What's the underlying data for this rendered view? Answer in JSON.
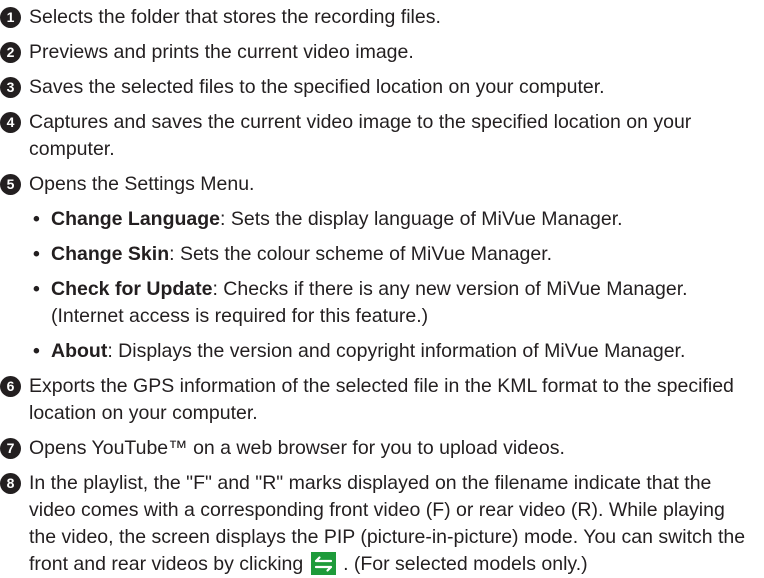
{
  "items": [
    {
      "num": "1",
      "text": "Selects the folder that stores the recording files."
    },
    {
      "num": "2",
      "text": "Previews and prints the current video image."
    },
    {
      "num": "3",
      "text": "Saves the selected files to the specified location on your computer."
    },
    {
      "num": "4",
      "text": "Captures and saves the current video image to the specified location on your computer."
    },
    {
      "num": "5",
      "text": "Opens the Settings Menu."
    },
    {
      "num": "6",
      "text": "Exports the GPS information of the selected file in the KML format to the specified location on your computer."
    },
    {
      "num": "7",
      "text": "Opens YouTube™ on a web browser for you to upload videos."
    },
    {
      "num": "8",
      "text_before_icon": "In the playlist, the \"F\" and \"R\" marks displayed on the filename indicate that the video comes with a corresponding front video (F) or rear video (R). While playing the video, the screen displays the PIP (picture-in-picture) mode. You can switch the front and rear videos by clicking",
      "text_after_icon": ". (For selected models only.)"
    }
  ],
  "settings_menu": [
    {
      "bullet": "•",
      "term": "Change Language",
      "desc": ": Sets the display language of MiVue Manager."
    },
    {
      "bullet": "•",
      "term": "Change Skin",
      "desc": ": Sets the colour scheme of MiVue Manager."
    },
    {
      "bullet": "•",
      "term": "Check for Update",
      "desc": ": Checks if there is any new version of MiVue Manager. (Internet access is required for this feature.)"
    },
    {
      "bullet": "•",
      "term": "About",
      "desc": ": Displays the version and copyright information of MiVue Manager."
    }
  ],
  "icons": {
    "swap": "swap-arrows-icon",
    "swap_color": "#1e9b3a"
  }
}
